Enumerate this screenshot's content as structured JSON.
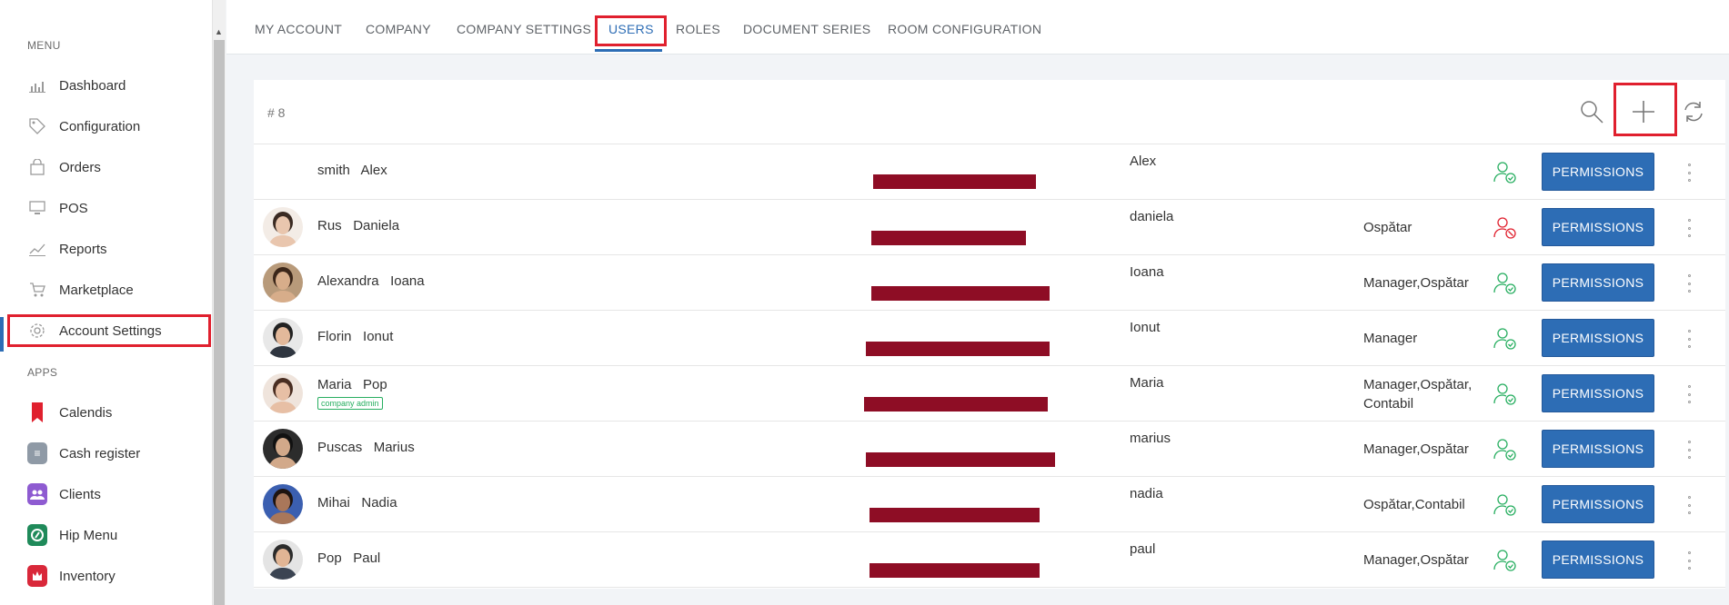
{
  "sidebar": {
    "menu_title": "MENU",
    "apps_title": "APPS",
    "menu_items": [
      {
        "label": "Dashboard",
        "icon": "chart-bar-icon"
      },
      {
        "label": "Configuration",
        "icon": "tag-icon"
      },
      {
        "label": "Orders",
        "icon": "shopping-bag-icon"
      },
      {
        "label": "POS",
        "icon": "monitor-icon"
      },
      {
        "label": "Reports",
        "icon": "line-chart-icon"
      },
      {
        "label": "Marketplace",
        "icon": "cart-icon"
      },
      {
        "label": "Account Settings",
        "icon": "gear-icon"
      }
    ],
    "apps": [
      {
        "label": "Calendis",
        "icon": "bookmark-icon",
        "color": "#e0202e"
      },
      {
        "label": "Cash register",
        "icon": "cash-register-icon",
        "color": "#8f9aa6"
      },
      {
        "label": "Clients",
        "icon": "users-icon",
        "color": "#8e5bd1"
      },
      {
        "label": "Hip Menu",
        "icon": "hip-menu-icon",
        "color": "#1f8a5a"
      },
      {
        "label": "Inventory",
        "icon": "inventory-icon",
        "color": "#d9283a"
      }
    ]
  },
  "tabs": [
    "MY ACCOUNT",
    "COMPANY",
    "COMPANY SETTINGS",
    "USERS",
    "ROLES",
    "DOCUMENT SERIES",
    "ROOM CONFIGURATION"
  ],
  "active_tab": "USERS",
  "users_count": "# 8",
  "permissions_label": "PERMISSIONS",
  "admin_badge": "company admin",
  "colors": {
    "primary": "#2d6db5",
    "highlight": "#e0202e",
    "redaction": "#8e0d25",
    "status_ok": "#27ae60",
    "status_off": "#e0202e"
  },
  "users": [
    {
      "first": "smith",
      "last": "Alex",
      "username": "Alex",
      "roles": "",
      "status": "active",
      "avatar": "none",
      "admin": false
    },
    {
      "first": "Rus",
      "last": "Daniela",
      "username": "daniela",
      "roles": "Ospătar",
      "status": "inactive",
      "avatar": "woman-light",
      "admin": false
    },
    {
      "first": "Alexandra",
      "last": "Ioana",
      "username": "Ioana",
      "roles": "Manager,Ospătar",
      "status": "active",
      "avatar": "woman-dark",
      "admin": false
    },
    {
      "first": "Florin",
      "last": "Ionut",
      "username": "Ionut",
      "roles": "Manager",
      "status": "active",
      "avatar": "man-suit",
      "admin": false
    },
    {
      "first": "Maria",
      "last": "Pop",
      "username": "Maria",
      "roles": "Manager,Ospătar,\nContabil",
      "status": "active",
      "avatar": "woman-face",
      "admin": true
    },
    {
      "first": "Puscas",
      "last": "Marius",
      "username": "marius",
      "roles": "Manager,Ospătar",
      "status": "active",
      "avatar": "man-dark",
      "admin": false
    },
    {
      "first": "Mihai",
      "last": "Nadia",
      "username": "nadia",
      "roles": "Ospătar,Contabil",
      "status": "active",
      "avatar": "woman-blue",
      "admin": false
    },
    {
      "first": "Pop",
      "last": "Paul",
      "username": "paul",
      "roles": "Manager,Ospătar",
      "status": "active",
      "avatar": "man-light",
      "admin": false
    }
  ]
}
